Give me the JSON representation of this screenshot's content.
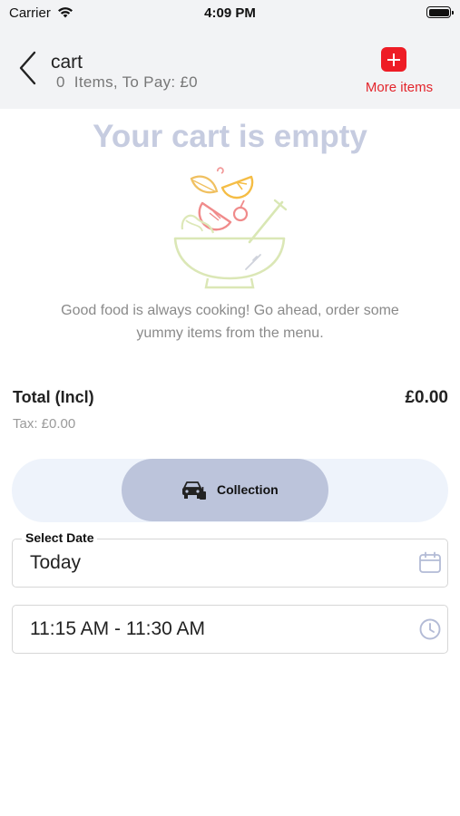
{
  "status_bar": {
    "carrier": "Carrier",
    "time": "4:09 PM"
  },
  "header": {
    "title": "cart",
    "subtitle": "0  Items, To Pay: £0",
    "more_items_label": "More items"
  },
  "empty_state": {
    "title": "Your cart is empty",
    "message": "Good food is always cooking! Go ahead, order some yummy items from the menu.",
    "illustration": "salad-bowl-illustration"
  },
  "totals": {
    "total_label": "Total (Incl)",
    "total_value": "£0.00",
    "tax_label": "Tax: £0.00"
  },
  "order_mode": {
    "selected_label": "Collection",
    "icon": "car-icon"
  },
  "date_field": {
    "label": "Select Date",
    "value": "Today",
    "icon": "calendar-icon"
  },
  "time_field": {
    "value": "11:15 AM - 11:30 AM",
    "icon": "clock-icon"
  },
  "colors": {
    "accent_red": "#ee1c25",
    "empty_title": "#c6cce0",
    "mode_pill": "#bcc4db",
    "mode_track": "#eef3fb",
    "header_bg": "#f2f3f5"
  }
}
